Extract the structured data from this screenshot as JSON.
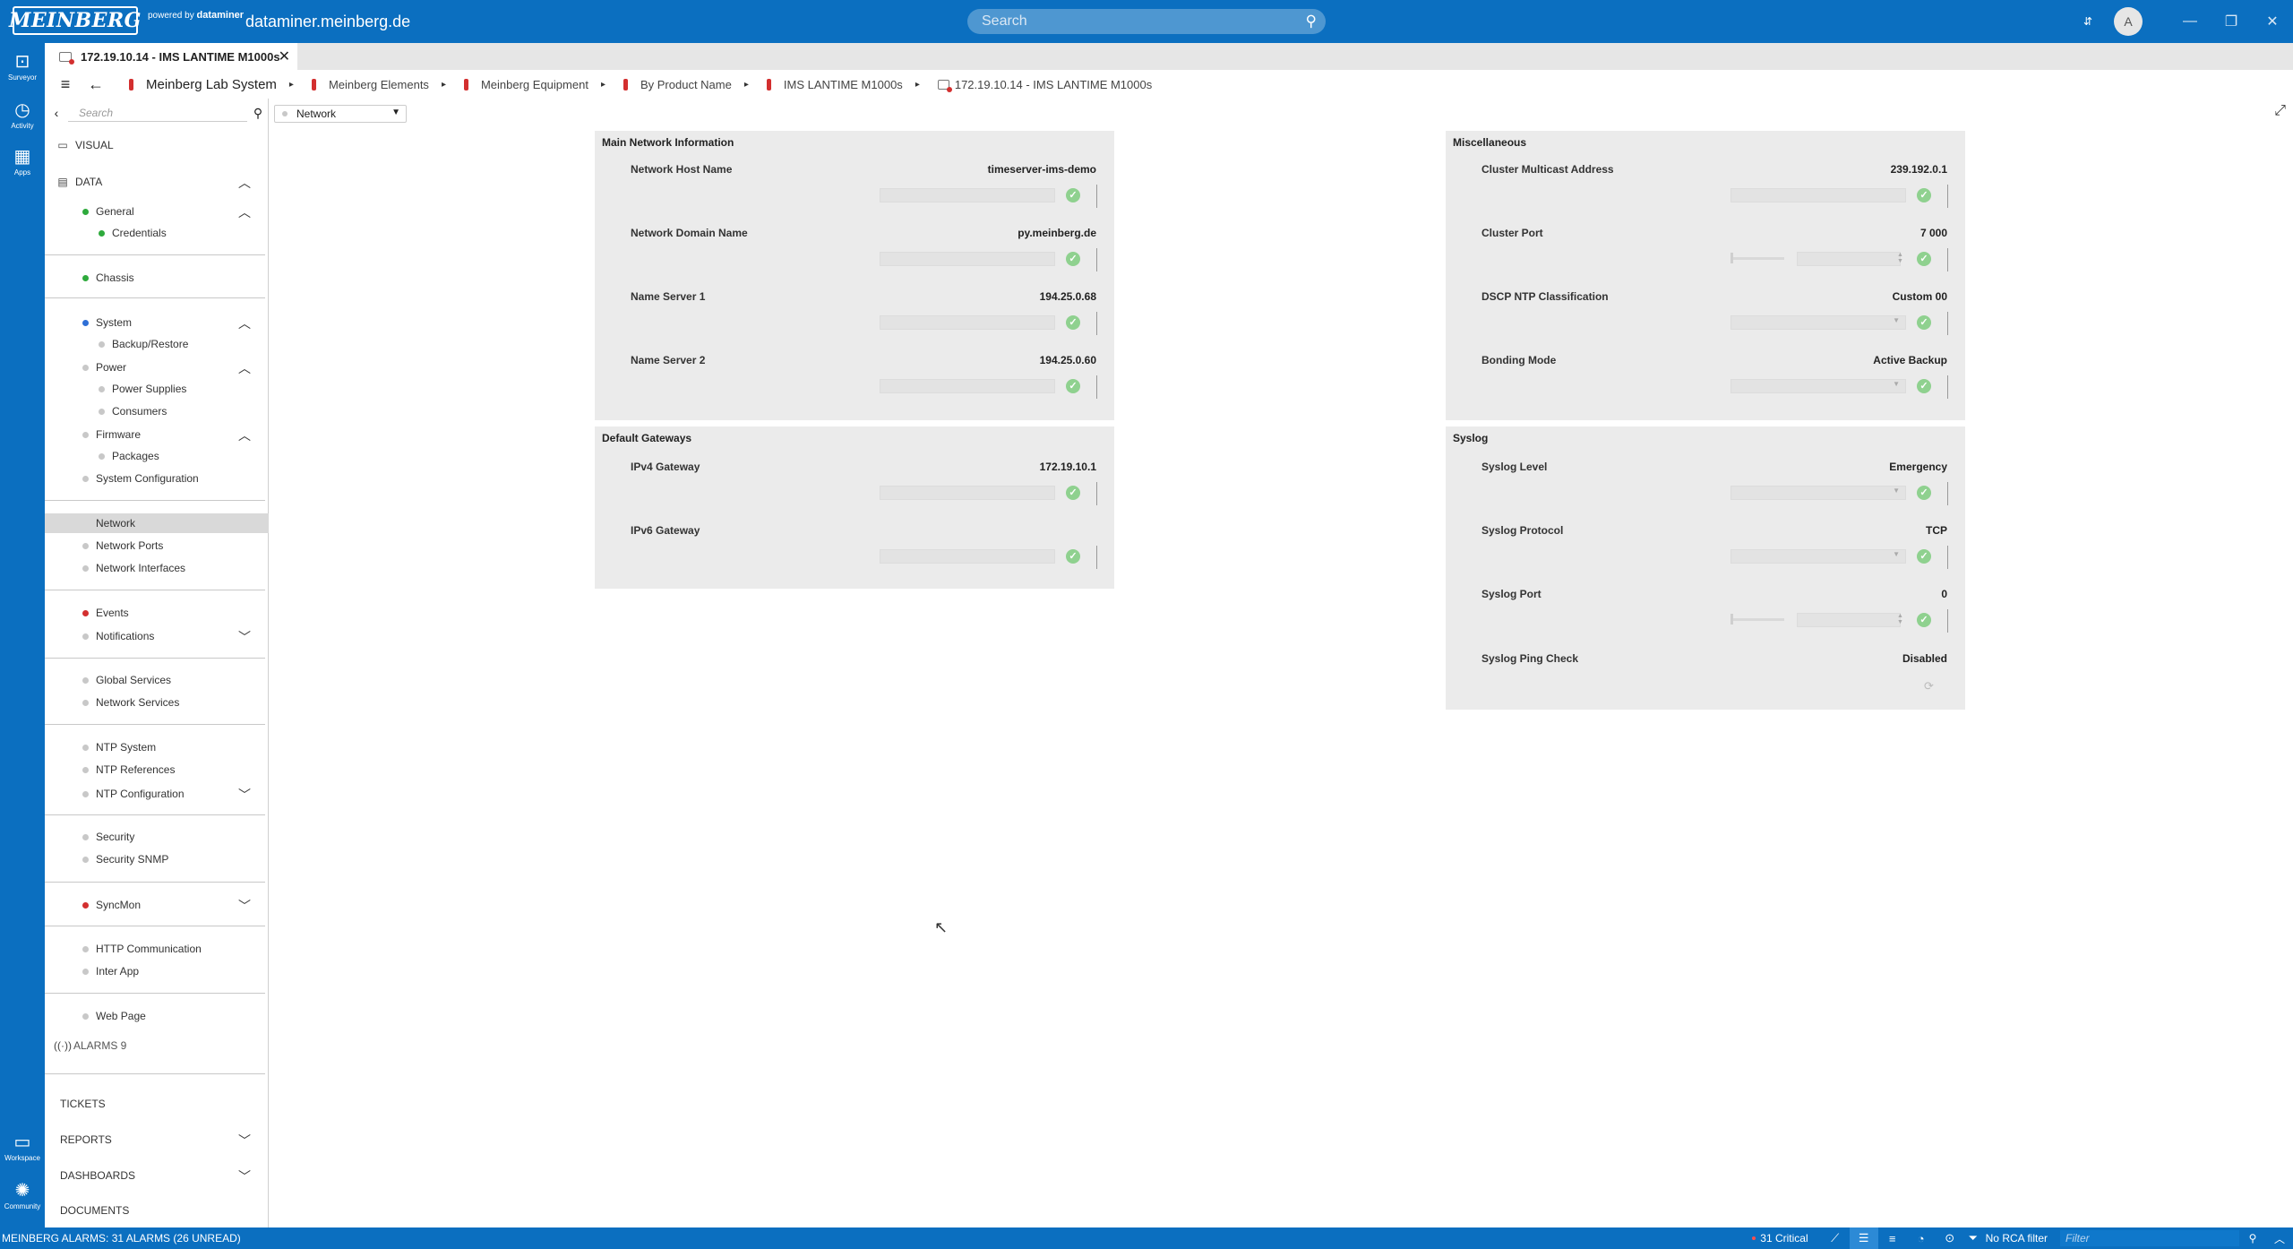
{
  "top": {
    "logo": "MEINBERG",
    "powered_by": "powered by",
    "powered_brand": "dataminer",
    "host": "dataminer.meinberg.de",
    "search_placeholder": "Search",
    "avatar": "A"
  },
  "rail": {
    "surveyor": "Surveyor",
    "activity": "Activity",
    "apps": "Apps",
    "workspace": "Workspace",
    "community": "Community"
  },
  "tab": {
    "label": "172.19.10.14 - IMS LANTIME M1000s"
  },
  "breadcrumb": [
    "Meinberg Lab System",
    "Meinberg Elements",
    "Meinberg Equipment",
    "By Product Name",
    "IMS LANTIME M1000s",
    "172.19.10.14 - IMS LANTIME M1000s"
  ],
  "sidebar": {
    "search_placeholder": "Search",
    "visual": "VISUAL",
    "data": "DATA",
    "items": {
      "general": "General",
      "credentials": "Credentials",
      "chassis": "Chassis",
      "system": "System",
      "backup_restore": "Backup/Restore",
      "power": "Power",
      "power_supplies": "Power Supplies",
      "consumers": "Consumers",
      "firmware": "Firmware",
      "packages": "Packages",
      "system_configuration": "System Configuration",
      "network": "Network",
      "network_ports": "Network Ports",
      "network_interfaces": "Network Interfaces",
      "events": "Events",
      "notifications": "Notifications",
      "global_services": "Global Services",
      "network_services": "Network Services",
      "ntp_system": "NTP System",
      "ntp_references": "NTP References",
      "ntp_configuration": "NTP Configuration",
      "security": "Security",
      "security_snmp": "Security SNMP",
      "syncmon": "SyncMon",
      "http_communication": "HTTP Communication",
      "inter_app": "Inter App",
      "web_page": "Web Page"
    },
    "alarms": "ALARMS 9",
    "tickets": "TICKETS",
    "reports": "REPORTS",
    "dashboards": "DASHBOARDS",
    "documents": "DOCUMENTS"
  },
  "view_select": "Network",
  "panels": {
    "main_network": {
      "title": "Main Network Information",
      "rows": [
        {
          "label": "Network Host Name",
          "value": "timeserver-ims-demo"
        },
        {
          "label": "Network Domain Name",
          "value": "py.meinberg.de"
        },
        {
          "label": "Name Server 1",
          "value": "194.25.0.68"
        },
        {
          "label": "Name Server 2",
          "value": "194.25.0.60"
        }
      ]
    },
    "gateways": {
      "title": "Default Gateways",
      "rows": [
        {
          "label": "IPv4 Gateway",
          "value": "172.19.10.1"
        },
        {
          "label": "IPv6 Gateway",
          "value": ""
        }
      ]
    },
    "misc": {
      "title": "Miscellaneous",
      "rows": [
        {
          "label": "Cluster Multicast Address",
          "value": "239.192.0.1"
        },
        {
          "label": "Cluster Port",
          "value": "7 000"
        },
        {
          "label": "DSCP NTP Classification",
          "value": "Custom 00"
        },
        {
          "label": "Bonding Mode",
          "value": "Active Backup"
        }
      ]
    },
    "syslog": {
      "title": "Syslog",
      "rows": [
        {
          "label": "Syslog Level",
          "value": "Emergency"
        },
        {
          "label": "Syslog Protocol",
          "value": "TCP"
        },
        {
          "label": "Syslog Port",
          "value": "0"
        },
        {
          "label": "Syslog Ping Check",
          "value": "Disabled"
        }
      ]
    }
  },
  "status": {
    "alarms": "MEINBERG ALARMS: 31 ALARMS (26 UNREAD)",
    "critical": "31 Critical",
    "rca": "No RCA filter",
    "filter_placeholder": "Filter"
  },
  "colors": {
    "brand": "#0b6fc0",
    "ok_check": "#8fd18f",
    "alarm_red": "#d32f2f",
    "panel_bg": "#ebebeb"
  }
}
